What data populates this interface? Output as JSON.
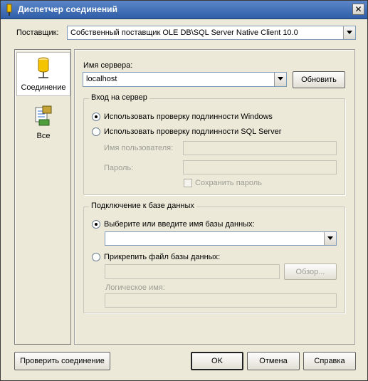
{
  "window": {
    "title": "Диспетчер соединений",
    "close_glyph": "✕"
  },
  "provider": {
    "label": "Поставщик:",
    "value": "Собственный поставщик OLE DB\\SQL Server Native Client 10.0"
  },
  "sidebar": {
    "items": [
      {
        "label": "Соединение",
        "icon": "database-cylinder-icon",
        "selected": true
      },
      {
        "label": "Все",
        "icon": "properties-list-icon",
        "selected": false
      }
    ]
  },
  "server": {
    "label": "Имя сервера:",
    "value": "localhost",
    "refresh_label": "Обновить"
  },
  "logon": {
    "group_title": "Вход на сервер",
    "windows_auth_label": "Использовать проверку подлинности Windows",
    "sql_auth_label": "Использовать проверку подлинности SQL Server",
    "selected": "windows",
    "username_label": "Имя пользователя:",
    "username_value": "",
    "password_label": "Пароль:",
    "password_value": "",
    "save_password_label": "Сохранить пароль",
    "save_password_checked": false
  },
  "database": {
    "group_title": "Подключение к базе данных",
    "select_db_label": "Выберите или введите имя базы данных:",
    "db_value": "",
    "attach_label": "Прикрепить файл базы данных:",
    "attach_value": "",
    "browse_label": "Обзор...",
    "logical_name_label": "Логическое имя:",
    "logical_name_value": "",
    "selected": "select"
  },
  "footer": {
    "test_label": "Проверить соединение",
    "ok_label": "OK",
    "cancel_label": "Отмена",
    "help_label": "Справка"
  },
  "colors": {
    "titlebar": "#2f5ea8",
    "dialog_bg": "#ece9d8",
    "disabled_text": "#9d9d93"
  }
}
